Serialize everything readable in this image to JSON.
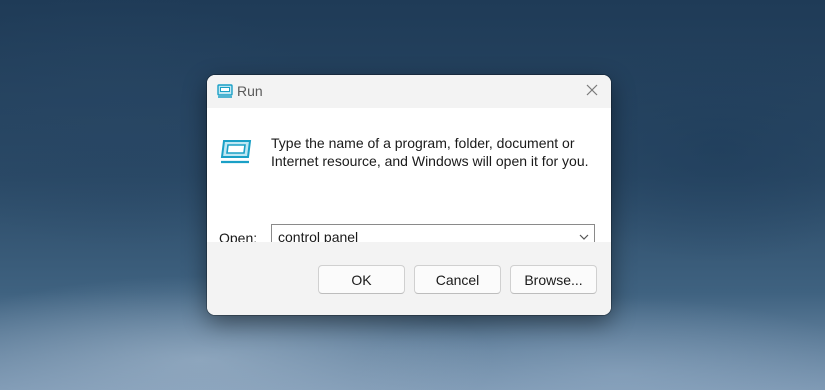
{
  "dialog": {
    "title": "Run",
    "title_icon": "run-icon",
    "close_icon": "close-icon",
    "app_icon": "run-app-icon",
    "description": "Type the name of a program, folder, document or Internet resource, and Windows will open it for you.",
    "open_label": "Open:",
    "open_value": "control panel",
    "dropdown_icon": "chevron-down-icon",
    "buttons": {
      "ok": "OK",
      "cancel": "Cancel",
      "browse": "Browse..."
    }
  },
  "colors": {
    "accent": "#0f6cbd",
    "icon_blue": "#1aa0c6"
  }
}
